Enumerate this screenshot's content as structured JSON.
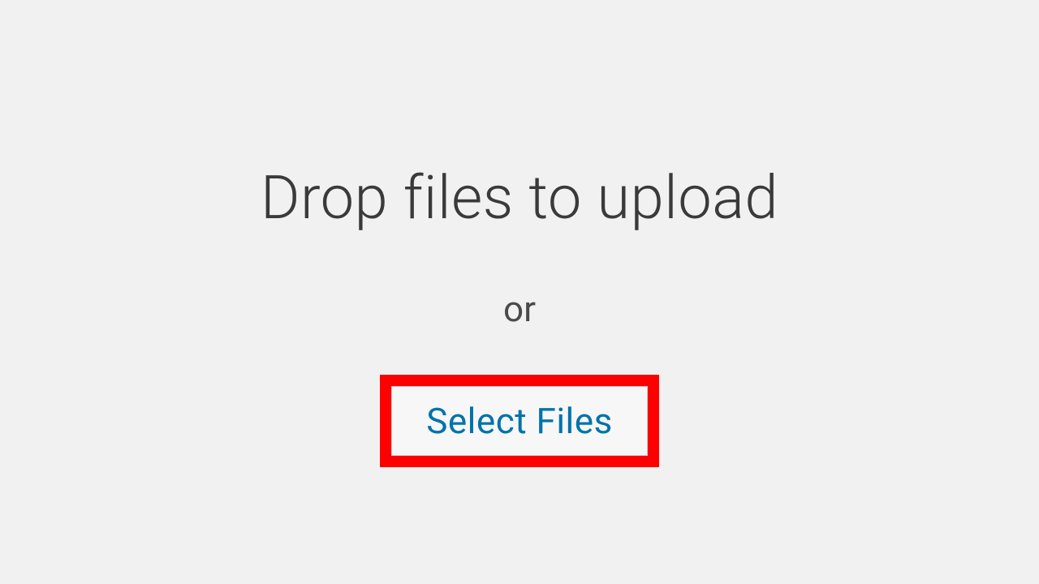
{
  "upload": {
    "heading": "Drop files to upload",
    "or_label": "or",
    "select_button_label": "Select Files"
  },
  "colors": {
    "highlight": "#ff0000",
    "link": "#0073aa",
    "background": "#f1f1f1"
  }
}
